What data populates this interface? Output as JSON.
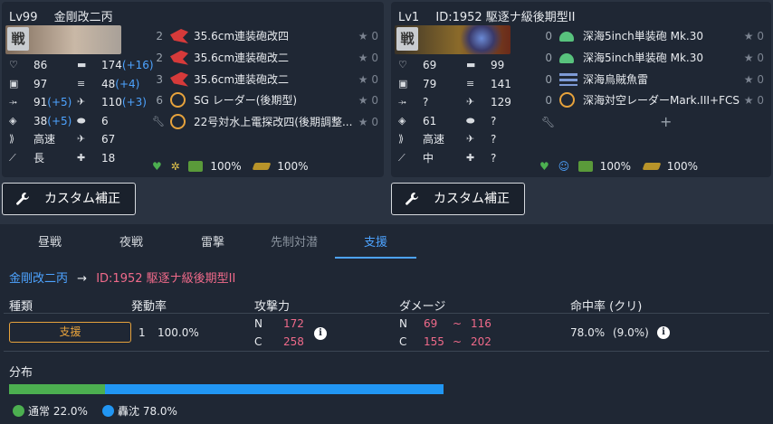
{
  "ships": [
    {
      "level": "Lv99",
      "name": "金剛改二丙",
      "banner_tag": "戦",
      "banner_colors": [
        "#7d6a5a",
        "#c9b8a6"
      ],
      "stats": [
        {
          "icon": "hp-icon",
          "value": "86",
          "plus": ""
        },
        {
          "icon": "firepower-icon",
          "value": "174",
          "plus": "(+16)"
        },
        {
          "icon": "armor-icon",
          "value": "97",
          "plus": ""
        },
        {
          "icon": "torpedo-icon",
          "value": "48",
          "plus": "(+4)"
        },
        {
          "icon": "evasion-icon",
          "value": "91",
          "plus": "(+5)"
        },
        {
          "icon": "antiair-icon",
          "value": "110",
          "plus": "(+3)"
        },
        {
          "icon": "los-icon",
          "value": "38",
          "plus": "(+5)"
        },
        {
          "icon": "asw-icon",
          "value": "6",
          "plus": ""
        },
        {
          "icon": "speed-icon",
          "value": "高速",
          "plus": ""
        },
        {
          "icon": "aircraft-icon",
          "value": "67",
          "plus": ""
        },
        {
          "icon": "range-icon",
          "value": "長",
          "plus": ""
        },
        {
          "icon": "luck-icon",
          "value": "18",
          "plus": ""
        }
      ],
      "equipment": [
        {
          "slot": "2",
          "icon": "main-gun-red-icon",
          "color": "#d63a3a",
          "name": "35.6cm連装砲改四",
          "star": "★ 0"
        },
        {
          "slot": "2",
          "icon": "main-gun-red-icon",
          "color": "#d63a3a",
          "name": "35.6cm連装砲改二",
          "star": "★ 0"
        },
        {
          "slot": "3",
          "icon": "main-gun-red-icon",
          "color": "#d63a3a",
          "name": "35.6cm連装砲改二",
          "star": "★ 0"
        },
        {
          "slot": "6",
          "icon": "radar-icon",
          "color": "#e6a23c",
          "name": "SG レーダー(後期型)",
          "star": "★ 0"
        },
        {
          "slot": "",
          "icon": "radar-icon",
          "color": "#e6a23c",
          "name": "22号対水上電探改四(後期調整...",
          "star": "★ 0"
        }
      ],
      "bottom": {
        "cond": "",
        "fuel": "100%",
        "ammo": "100%"
      }
    },
    {
      "level": "Lv1",
      "name": "ID:1952 駆逐ナ級後期型II",
      "banner_tag": "戦",
      "banner_colors": [
        "#3a3328",
        "#8a6a2a"
      ],
      "stats": [
        {
          "icon": "hp-icon",
          "value": "69",
          "plus": ""
        },
        {
          "icon": "firepower-icon",
          "value": "99",
          "plus": ""
        },
        {
          "icon": "armor-icon",
          "value": "79",
          "plus": ""
        },
        {
          "icon": "torpedo-icon",
          "value": "141",
          "plus": ""
        },
        {
          "icon": "evasion-icon",
          "value": "?",
          "plus": ""
        },
        {
          "icon": "antiair-icon",
          "value": "129",
          "plus": ""
        },
        {
          "icon": "los-icon",
          "value": "61",
          "plus": ""
        },
        {
          "icon": "asw-icon",
          "value": "?",
          "plus": ""
        },
        {
          "icon": "speed-icon",
          "value": "高速",
          "plus": ""
        },
        {
          "icon": "aircraft-icon",
          "value": "?",
          "plus": ""
        },
        {
          "icon": "range-icon",
          "value": "中",
          "plus": ""
        },
        {
          "icon": "luck-icon",
          "value": "?",
          "plus": ""
        }
      ],
      "equipment": [
        {
          "slot": "0",
          "icon": "secondary-gun-green-icon",
          "color": "#58c27d",
          "name": "深海5inch単装砲 Mk.30",
          "star": "★ 0"
        },
        {
          "slot": "0",
          "icon": "secondary-gun-green-icon",
          "color": "#58c27d",
          "name": "深海5inch単装砲 Mk.30",
          "star": "★ 0"
        },
        {
          "slot": "0",
          "icon": "torpedo-blue-icon",
          "color": "#7d9ad6",
          "name": "深海烏賊魚雷",
          "star": "★ 0"
        },
        {
          "slot": "0",
          "icon": "radar-icon",
          "color": "#e6a23c",
          "name": "深海対空レーダーMark.III+FCS",
          "star": "★ 0"
        }
      ],
      "add_slot": "+",
      "bottom": {
        "cond": "",
        "fuel": "100%",
        "ammo": "100%"
      }
    }
  ],
  "custom_button_label": "カスタム補正",
  "tabs": [
    {
      "label": "昼戦",
      "state": "normal"
    },
    {
      "label": "夜戦",
      "state": "normal"
    },
    {
      "label": "雷撃",
      "state": "normal"
    },
    {
      "label": "先制対潜",
      "state": "dim"
    },
    {
      "label": "支援",
      "state": "active"
    }
  ],
  "route": {
    "attacker": "金剛改二丙",
    "arrow": "→",
    "defender": "ID:1952 駆逐ナ級後期型II"
  },
  "table": {
    "headers": [
      "種類",
      "発動率",
      "攻撃力",
      "ダメージ",
      "命中率 (クリ)"
    ],
    "row": {
      "type": "支援",
      "count": "1",
      "rate": "100.0%",
      "power": [
        {
          "label": "N",
          "value": "172"
        },
        {
          "label": "C",
          "value": "258"
        }
      ],
      "damage": [
        {
          "label": "N",
          "min": "69",
          "sep": "~",
          "max": "116"
        },
        {
          "label": "C",
          "min": "155",
          "sep": "~",
          "max": "202"
        }
      ],
      "hit": "78.0%",
      "crit": "(9.0%)"
    }
  },
  "distribution": {
    "title": "分布",
    "normal_label": "通常 22.0%",
    "sink_label": "轟沈 78.0%",
    "normal_fraction": 0.22,
    "sink_fraction": 0.78,
    "normal_color": "#4caf50",
    "sink_color": "#2196f3"
  },
  "colors": {
    "accent": "#4da3ff",
    "pink": "#f06a8a",
    "orange": "#e6a23c"
  }
}
